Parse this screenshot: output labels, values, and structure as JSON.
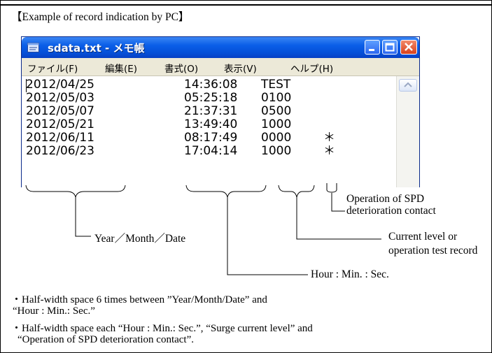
{
  "heading": "【Example of record indication by PC】",
  "window": {
    "title": "sdata.txt - メモ帳",
    "menu": [
      "ファイル(F)",
      "編集(E)",
      "書式(O)",
      "表示(V)",
      "ヘルプ(H)"
    ]
  },
  "records": [
    {
      "date": "2012/04/25",
      "time": "14:36:08",
      "level": "TEST",
      "mark": ""
    },
    {
      "date": "2012/05/03",
      "time": "05:25:18",
      "level": "0100",
      "mark": ""
    },
    {
      "date": "2012/05/07",
      "time": "21:37:31",
      "level": "0500",
      "mark": ""
    },
    {
      "date": "2012/05/21",
      "time": "13:49:40",
      "level": "1000",
      "mark": ""
    },
    {
      "date": "2012/06/11",
      "time": "08:17:49",
      "level": "0000",
      "mark": "＊"
    },
    {
      "date": "2012/06/23",
      "time": "17:04:14",
      "level": "1000",
      "mark": "＊"
    }
  ],
  "annotations": {
    "ymd": "Year／Month／Date",
    "hms": "Hour : Min. : Sec.",
    "current_line1": "Current level or",
    "current_line2": "operation test record",
    "spd_line1": "Operation of SPD",
    "spd_line2": "deterioration contact"
  },
  "notes": [
    "・Half-width space 6 times between ”Year/Month/Date” and",
    "“Hour : Min.: Sec.”",
    "・Half-width space each “Hour : Min.: Sec.”, “Surge current level” and",
    "“Operation of SPD deterioration contact”."
  ],
  "colors": {
    "titlebar": "#0a5ee8",
    "menubar": "#ece9d8",
    "close_button": "#d8401c"
  }
}
